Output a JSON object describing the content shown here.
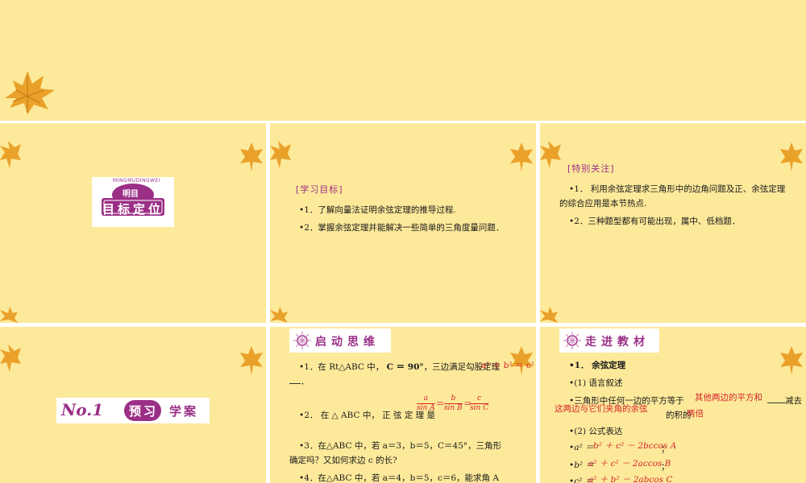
{
  "colors": {
    "panel_bg": "#fde99a",
    "accent_pink": "#9b2f86",
    "answer_red": "#d4242b"
  },
  "slide2": {
    "badge_arc": "MINGMUDINGWEI",
    "badge_small": "明目",
    "badge_title": "目标定位"
  },
  "slide3": {
    "tag": "[学习目标]",
    "items": [
      "•1．了解向量法证明余弦定理的推导过程.",
      "•2．掌握余弦定理并能解决一些简单的三角度量问题．"
    ]
  },
  "slide4": {
    "tag": "[特别关注]",
    "item1_line1": "•1． 利用余弦定理求三角形中的边角问题及正、余弦定理",
    "item1_line2": "的综合应用是本节热点.",
    "item2": "•2．三种题型都有可能出现，属中、低档题．"
  },
  "slide5": {
    "logo": "No.1",
    "title_a": "预习",
    "title_b": "学案"
  },
  "slide6": {
    "header": "启动思维",
    "q1_a": "•1．在 Rt△ABC 中，",
    "q1_c": "C ＝ 90°",
    "q1_b": "，三边满足勾股定理",
    "q1_answer": "a² ＋ b² ＝ c²",
    "q1_end": "．",
    "q2": "•2． 在 △ ABC 中， 正 弦 定 理 是",
    "frac1_num": "a",
    "frac1_den": "sin A",
    "frac2_num": "b",
    "frac2_den": "sin B",
    "frac3_num": "c",
    "frac3_den": "sin C",
    "q3_line1": "•3．在△ABC 中，若 a＝3，b＝5，C＝45°，三角形",
    "q3_line2": "确定吗？又如何求边 c 的长?",
    "q4": "•4．在△ABC 中，若 a＝4，b＝5，c＝6，能求角 A"
  },
  "slide7": {
    "header": "走进教材",
    "s1": "•1． 余弦定理",
    "s1a": "•(1) 语言叙述",
    "s1a_line": "•三角形中任何一边的平方等于",
    "s1a_ans1": "其他两边的平方和",
    "s1a_mid": "减去",
    "s1a_ans2": "这两边与它们夹角的余弦",
    "s1a_tail": "的积的",
    "s1a_ans3": "两倍",
    "s1b": "•(2) 公式表达",
    "f1_lhs": "•a² ＝",
    "f1_ans": "b² ＋ c² － 2bccos A",
    "f2_lhs": "•b² ＝",
    "f2_ans": "a² ＋ c² － 2accos B",
    "f3_lhs": "•c² ＝",
    "f3_ans": "a² ＋ b² － 2abcos C",
    "sep": "；"
  }
}
